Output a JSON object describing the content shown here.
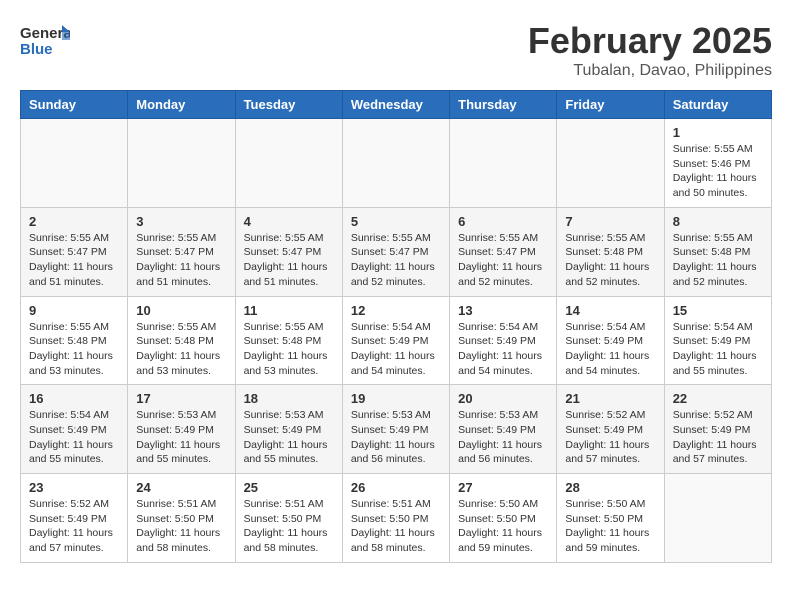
{
  "header": {
    "logo_general": "General",
    "logo_blue": "Blue",
    "title": "February 2025",
    "subtitle": "Tubalan, Davao, Philippines"
  },
  "weekdays": [
    "Sunday",
    "Monday",
    "Tuesday",
    "Wednesday",
    "Thursday",
    "Friday",
    "Saturday"
  ],
  "weeks": [
    [
      {
        "day": "",
        "info": ""
      },
      {
        "day": "",
        "info": ""
      },
      {
        "day": "",
        "info": ""
      },
      {
        "day": "",
        "info": ""
      },
      {
        "day": "",
        "info": ""
      },
      {
        "day": "",
        "info": ""
      },
      {
        "day": "1",
        "info": "Sunrise: 5:55 AM\nSunset: 5:46 PM\nDaylight: 11 hours\nand 50 minutes."
      }
    ],
    [
      {
        "day": "2",
        "info": "Sunrise: 5:55 AM\nSunset: 5:47 PM\nDaylight: 11 hours\nand 51 minutes."
      },
      {
        "day": "3",
        "info": "Sunrise: 5:55 AM\nSunset: 5:47 PM\nDaylight: 11 hours\nand 51 minutes."
      },
      {
        "day": "4",
        "info": "Sunrise: 5:55 AM\nSunset: 5:47 PM\nDaylight: 11 hours\nand 51 minutes."
      },
      {
        "day": "5",
        "info": "Sunrise: 5:55 AM\nSunset: 5:47 PM\nDaylight: 11 hours\nand 52 minutes."
      },
      {
        "day": "6",
        "info": "Sunrise: 5:55 AM\nSunset: 5:47 PM\nDaylight: 11 hours\nand 52 minutes."
      },
      {
        "day": "7",
        "info": "Sunrise: 5:55 AM\nSunset: 5:48 PM\nDaylight: 11 hours\nand 52 minutes."
      },
      {
        "day": "8",
        "info": "Sunrise: 5:55 AM\nSunset: 5:48 PM\nDaylight: 11 hours\nand 52 minutes."
      }
    ],
    [
      {
        "day": "9",
        "info": "Sunrise: 5:55 AM\nSunset: 5:48 PM\nDaylight: 11 hours\nand 53 minutes."
      },
      {
        "day": "10",
        "info": "Sunrise: 5:55 AM\nSunset: 5:48 PM\nDaylight: 11 hours\nand 53 minutes."
      },
      {
        "day": "11",
        "info": "Sunrise: 5:55 AM\nSunset: 5:48 PM\nDaylight: 11 hours\nand 53 minutes."
      },
      {
        "day": "12",
        "info": "Sunrise: 5:54 AM\nSunset: 5:49 PM\nDaylight: 11 hours\nand 54 minutes."
      },
      {
        "day": "13",
        "info": "Sunrise: 5:54 AM\nSunset: 5:49 PM\nDaylight: 11 hours\nand 54 minutes."
      },
      {
        "day": "14",
        "info": "Sunrise: 5:54 AM\nSunset: 5:49 PM\nDaylight: 11 hours\nand 54 minutes."
      },
      {
        "day": "15",
        "info": "Sunrise: 5:54 AM\nSunset: 5:49 PM\nDaylight: 11 hours\nand 55 minutes."
      }
    ],
    [
      {
        "day": "16",
        "info": "Sunrise: 5:54 AM\nSunset: 5:49 PM\nDaylight: 11 hours\nand 55 minutes."
      },
      {
        "day": "17",
        "info": "Sunrise: 5:53 AM\nSunset: 5:49 PM\nDaylight: 11 hours\nand 55 minutes."
      },
      {
        "day": "18",
        "info": "Sunrise: 5:53 AM\nSunset: 5:49 PM\nDaylight: 11 hours\nand 55 minutes."
      },
      {
        "day": "19",
        "info": "Sunrise: 5:53 AM\nSunset: 5:49 PM\nDaylight: 11 hours\nand 56 minutes."
      },
      {
        "day": "20",
        "info": "Sunrise: 5:53 AM\nSunset: 5:49 PM\nDaylight: 11 hours\nand 56 minutes."
      },
      {
        "day": "21",
        "info": "Sunrise: 5:52 AM\nSunset: 5:49 PM\nDaylight: 11 hours\nand 57 minutes."
      },
      {
        "day": "22",
        "info": "Sunrise: 5:52 AM\nSunset: 5:49 PM\nDaylight: 11 hours\nand 57 minutes."
      }
    ],
    [
      {
        "day": "23",
        "info": "Sunrise: 5:52 AM\nSunset: 5:49 PM\nDaylight: 11 hours\nand 57 minutes."
      },
      {
        "day": "24",
        "info": "Sunrise: 5:51 AM\nSunset: 5:50 PM\nDaylight: 11 hours\nand 58 minutes."
      },
      {
        "day": "25",
        "info": "Sunrise: 5:51 AM\nSunset: 5:50 PM\nDaylight: 11 hours\nand 58 minutes."
      },
      {
        "day": "26",
        "info": "Sunrise: 5:51 AM\nSunset: 5:50 PM\nDaylight: 11 hours\nand 58 minutes."
      },
      {
        "day": "27",
        "info": "Sunrise: 5:50 AM\nSunset: 5:50 PM\nDaylight: 11 hours\nand 59 minutes."
      },
      {
        "day": "28",
        "info": "Sunrise: 5:50 AM\nSunset: 5:50 PM\nDaylight: 11 hours\nand 59 minutes."
      },
      {
        "day": "",
        "info": ""
      }
    ]
  ]
}
